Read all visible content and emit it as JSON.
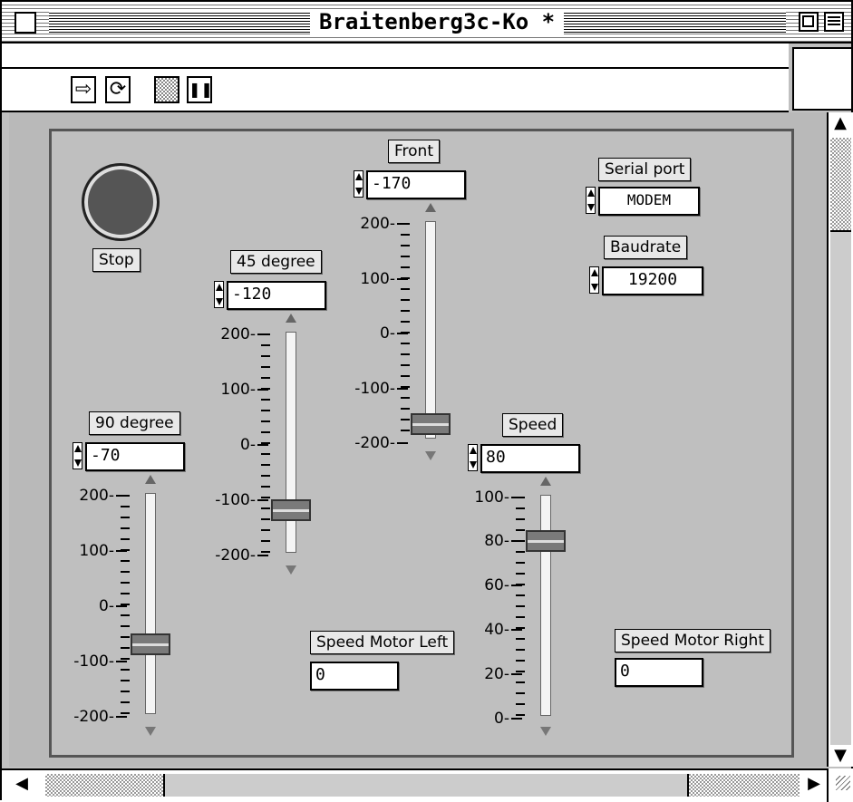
{
  "window": {
    "title": "Braitenberg3c-Ko *"
  },
  "toolbar": {
    "step_icon": "step-arrow-icon",
    "run_icon": "run-loop-icon",
    "stop_icon": "stop-octagon-icon",
    "pause_icon": "pause-icon",
    "step_glyph": "⇨",
    "run_glyph": "⟳",
    "pause_glyph": "❚❚"
  },
  "stop": {
    "label": "Stop"
  },
  "sliders": {
    "front": {
      "label": "Front",
      "value": "-170",
      "ticks": [
        "200-",
        "100-",
        "0-",
        "-100-",
        "-200-"
      ],
      "level": -170
    },
    "deg45": {
      "label": "45 degree",
      "value": "-120",
      "ticks": [
        "200-",
        "100-",
        "0-",
        "-100-",
        "-200-"
      ],
      "level": -120
    },
    "deg90": {
      "label": "90 degree",
      "value": "-70",
      "ticks": [
        "200-",
        "100-",
        "0-",
        "-100-",
        "-200-"
      ],
      "level": -70
    },
    "speed": {
      "label": "Speed",
      "value": "80",
      "ticks": [
        "100-",
        "80-",
        "60-",
        "40-",
        "20-",
        "0-"
      ],
      "level": 80
    }
  },
  "serial": {
    "label": "Serial port",
    "value": "MODEM"
  },
  "baud": {
    "label": "Baudrate",
    "value": "19200"
  },
  "motor_left": {
    "label": "Speed Motor Left",
    "value": "0"
  },
  "motor_right": {
    "label": "Speed Motor Right",
    "value": "0"
  }
}
